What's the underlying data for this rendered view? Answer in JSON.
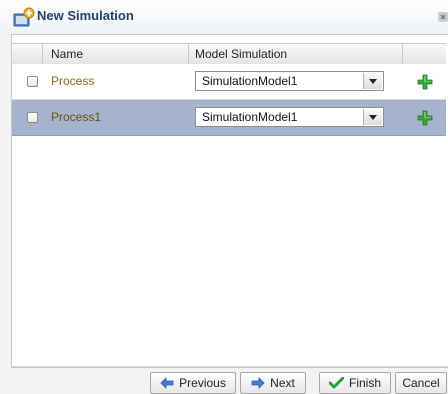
{
  "dialog": {
    "title": "New Simulation"
  },
  "table": {
    "columns": [
      "Name",
      "Model Simulation"
    ],
    "rows": [
      {
        "name": "Process",
        "model": "SimulationModel1",
        "selected": false
      },
      {
        "name": "Process1",
        "model": "SimulationModel1",
        "selected": true
      }
    ]
  },
  "footer": {
    "previous_label": "Previous",
    "next_label": "Next",
    "finish_label": "Finish",
    "cancel_label": "Cancel"
  },
  "colors": {
    "selected_row": "#a5b3cc",
    "title_text": "#1f3f78",
    "name_text": "#8a6b12",
    "add_icon": "#3aa53a"
  },
  "icons": {
    "title": "new-simulation-icon",
    "close": "close-icon",
    "add": "green-plus-icon",
    "previous": "left-arrow-icon",
    "next": "right-arrow-icon",
    "finish": "checkmark-icon",
    "dropdown": "chevron-down-icon"
  }
}
